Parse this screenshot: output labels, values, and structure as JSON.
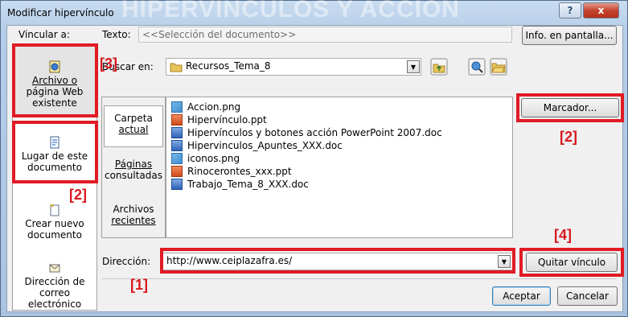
{
  "window": {
    "title": "Modificar hipervínculo",
    "title_bg_text": "HIPERVÍNCULOS Y ACCIÓN",
    "help_label": "?",
    "close_label": "x"
  },
  "link_to": {
    "label": "Vincular a:",
    "items": [
      {
        "line1": "Archivo o",
        "line2": "página Web",
        "line3": "existente"
      },
      {
        "line1": "Lugar de este",
        "line2": "documento"
      },
      {
        "line1": "Crear nuevo",
        "line2": "documento"
      },
      {
        "line1": "Dirección de",
        "line2": "correo",
        "line3": "electrónico"
      }
    ]
  },
  "text_field": {
    "label": "Texto:",
    "value": "<<Selección del documento>>"
  },
  "screentip_button": "Info. en pantalla...",
  "look_in": {
    "label": "Buscar en:",
    "value": "Recursos_Tema_8"
  },
  "browse_tabs": [
    {
      "line1": "Carpeta",
      "line2": "actual"
    },
    {
      "line1": "Páginas",
      "line2": "consultadas"
    },
    {
      "line1": "Archivos",
      "line2": "recientes"
    }
  ],
  "files": [
    {
      "name": "Accion.png",
      "type": "png"
    },
    {
      "name": "Hipervínculo.ppt",
      "type": "ppt"
    },
    {
      "name": "Hipervínculos y botones acción  PowerPoint 2007.doc",
      "type": "doc"
    },
    {
      "name": "Hipervinculos_Apuntes_XXX.doc",
      "type": "doc"
    },
    {
      "name": "iconos.png",
      "type": "png"
    },
    {
      "name": "Rinocerontes_xxx.ppt",
      "type": "ppt"
    },
    {
      "name": "Trabajo_Tema_8_XXX.doc",
      "type": "doc"
    }
  ],
  "bookmark_button": "Marcador...",
  "address": {
    "label": "Dirección:",
    "value": "http://www.ceiplazafra.es/"
  },
  "remove_link_button": "Quitar vínculo",
  "ok_button": "Aceptar",
  "cancel_button": "Cancelar",
  "annotations": {
    "label_1": "[1]",
    "label_2a": "[2]",
    "label_2b": "[2]",
    "label_3": "[3]",
    "label_4": "[4]",
    "color": "#e01b24"
  }
}
